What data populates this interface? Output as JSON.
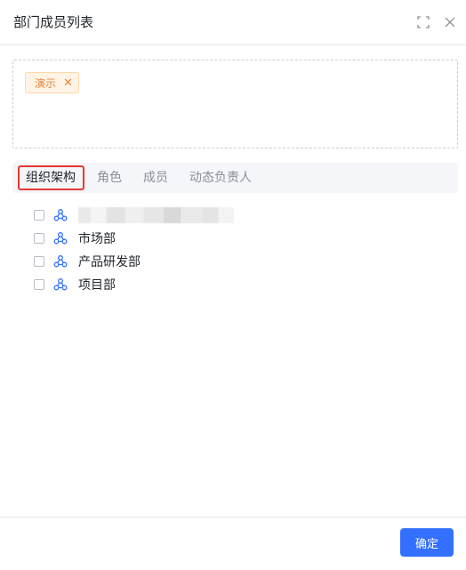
{
  "dialog": {
    "title": "部门成员列表",
    "icons": {
      "fullscreen": "fullscreen-icon",
      "close": "close-icon"
    }
  },
  "selected": {
    "tags": [
      {
        "label": "演示",
        "close": "✕"
      }
    ]
  },
  "tabs": [
    {
      "label": "组织架构",
      "active": true
    },
    {
      "label": "角色",
      "active": false
    },
    {
      "label": "成员",
      "active": false
    },
    {
      "label": "动态负责人",
      "active": false
    }
  ],
  "tree": [
    {
      "label": "",
      "blurred": true,
      "icon": "org-icon"
    },
    {
      "label": "市场部",
      "icon": "org-icon"
    },
    {
      "label": "产品研发部",
      "icon": "org-icon"
    },
    {
      "label": "项目部",
      "icon": "org-icon"
    }
  ],
  "footer": {
    "confirm_label": "确定"
  },
  "colors": {
    "primary": "#3370ff",
    "tag_text": "#e8833a",
    "highlight": "#e53935"
  }
}
